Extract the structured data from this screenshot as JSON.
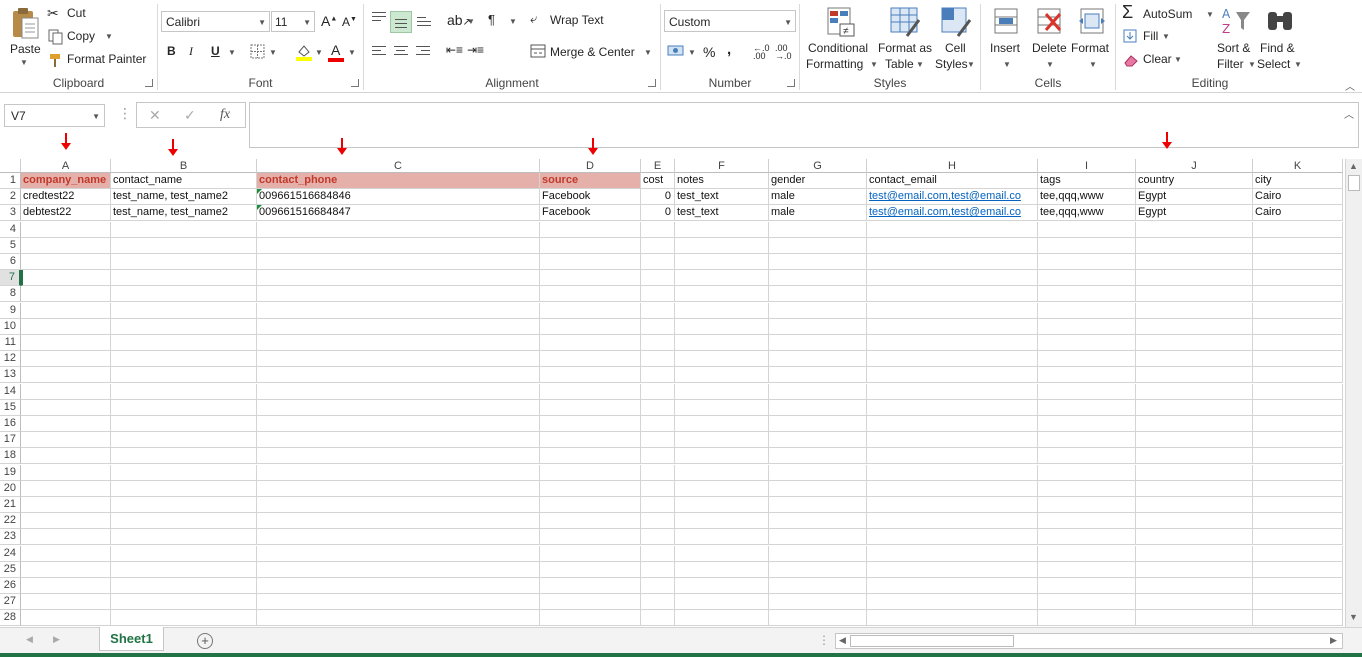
{
  "clipboard": {
    "paste": "Paste",
    "cut": "Cut",
    "copy": "Copy",
    "format_painter": "Format Painter",
    "label": "Clipboard"
  },
  "font": {
    "name": "Calibri",
    "size": "11",
    "bold": "B",
    "italic": "I",
    "underline": "U",
    "font_color_glyph": "A",
    "label": "Font"
  },
  "alignment": {
    "wrap_text": "Wrap Text",
    "merge_center": "Merge & Center",
    "label": "Alignment"
  },
  "number": {
    "format": "Custom",
    "percent": "%",
    "comma": ",",
    "label": "Number"
  },
  "styles": {
    "conditional": "Conditional",
    "formatting": "Formatting",
    "format_as": "Format as",
    "table": "Table",
    "cell": "Cell",
    "cell_styles": "Styles",
    "label": "Styles"
  },
  "cells": {
    "insert": "Insert",
    "delete": "Delete",
    "format": "Format",
    "label": "Cells"
  },
  "editing": {
    "autosum": "AutoSum",
    "fill": "Fill",
    "clear": "Clear",
    "sort": "Sort &",
    "filter": "Filter",
    "find": "Find &",
    "select": "Select",
    "label": "Editing"
  },
  "formula_bar": {
    "name_box": "V7",
    "fx": "fx",
    "value": ""
  },
  "columns": [
    "A",
    "B",
    "C",
    "D",
    "E",
    "F",
    "G",
    "H",
    "I",
    "J",
    "K"
  ],
  "rows": [
    "1",
    "2",
    "3",
    "4",
    "5",
    "6",
    "7",
    "8",
    "9",
    "10",
    "11",
    "12",
    "13",
    "14",
    "15",
    "16",
    "17",
    "18",
    "19",
    "20",
    "21",
    "22",
    "23",
    "24",
    "25",
    "26",
    "27",
    "28"
  ],
  "grid": [
    [
      "company_name",
      "contact_name",
      "contact_phone",
      "source",
      "cost",
      "notes",
      "gender",
      "contact_email",
      "tags",
      "country",
      "city"
    ],
    [
      "credtest22",
      "test_name, test_name2",
      "009661516684846",
      "Facebook",
      "0",
      "test_text",
      "male",
      "test@email.com,test@email.co",
      "tee,qqq,www",
      "Egypt",
      "Cairo"
    ],
    [
      "debtest22",
      "test_name, test_name2",
      "009661516684847",
      "Facebook",
      "0",
      "test_text",
      "male",
      "test@email.com,test@email.co",
      "tee,qqq,www",
      "Egypt",
      "Cairo"
    ]
  ],
  "sheet": {
    "tab": "Sheet1"
  },
  "colors": {
    "accent": "#217346",
    "highlight_fill": "#e6b0aa",
    "highlight_text": "#c0392b",
    "arrow": "#ee0000",
    "link": "#0563c1"
  }
}
